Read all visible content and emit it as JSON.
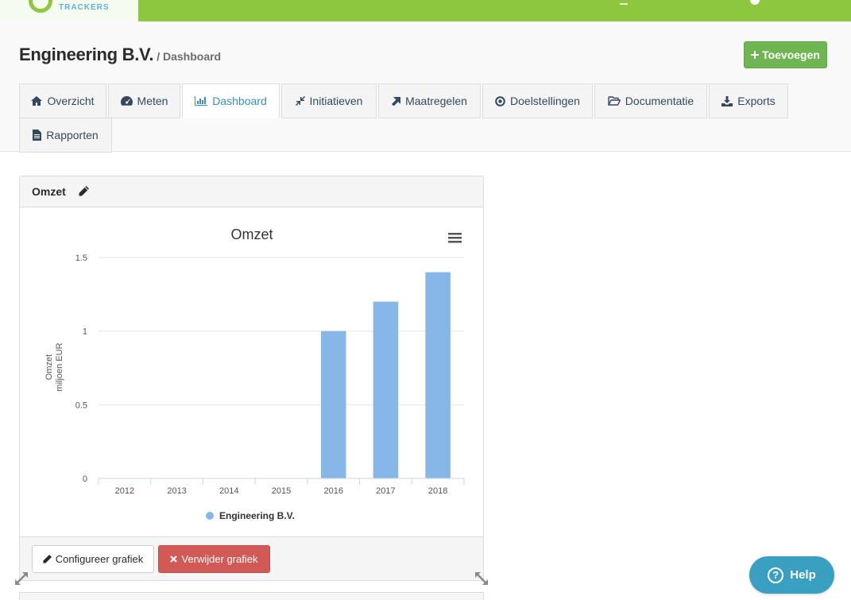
{
  "topbar": {
    "logo_text": "TRACKERS"
  },
  "header": {
    "title": "Engineering B.V.",
    "subtitle": "/ Dashboard",
    "add_label": "Toevoegen"
  },
  "tabs": [
    {
      "label": "Overzicht",
      "icon": "home-icon"
    },
    {
      "label": "Meten",
      "icon": "dashboard-gauge-icon"
    },
    {
      "label": "Dashboard",
      "icon": "bar-chart-icon",
      "active": true
    },
    {
      "label": "Initiatieven",
      "icon": "compress-arrows-icon"
    },
    {
      "label": "Maatregelen",
      "icon": "arrow-up-right-icon"
    },
    {
      "label": "Doelstellingen",
      "icon": "target-dot-icon"
    },
    {
      "label": "Documentatie",
      "icon": "folder-open-icon"
    },
    {
      "label": "Exports",
      "icon": "download-icon"
    },
    {
      "label": "Rapporten",
      "icon": "file-text-icon"
    }
  ],
  "widget": {
    "title": "Omzet",
    "configure_label": "Configureer grafiek",
    "delete_label": "Verwijder grafiek"
  },
  "chart_data": {
    "type": "bar",
    "title": "Omzet",
    "ylabel": [
      "Omzet",
      "miljoen EUR"
    ],
    "categories": [
      "2012",
      "2013",
      "2014",
      "2015",
      "2016",
      "2017",
      "2018"
    ],
    "series": [
      {
        "name": "Engineering B.V.",
        "values": [
          0,
          0,
          0,
          0,
          1.0,
          1.2,
          1.4
        ],
        "color": "#87b6e8"
      }
    ],
    "yticks": [
      "0",
      "0.5",
      "1",
      "1.5"
    ],
    "ylim": [
      0,
      1.5
    ],
    "grid": true,
    "legend": "bottom-center"
  },
  "help": {
    "label": "Help"
  },
  "colors": {
    "brand_green": "#8dc63f",
    "add_button": "#6fb552",
    "delete_button": "#d25a56",
    "active_tab": "#3a8fc8",
    "help": "#3aa0c2"
  }
}
